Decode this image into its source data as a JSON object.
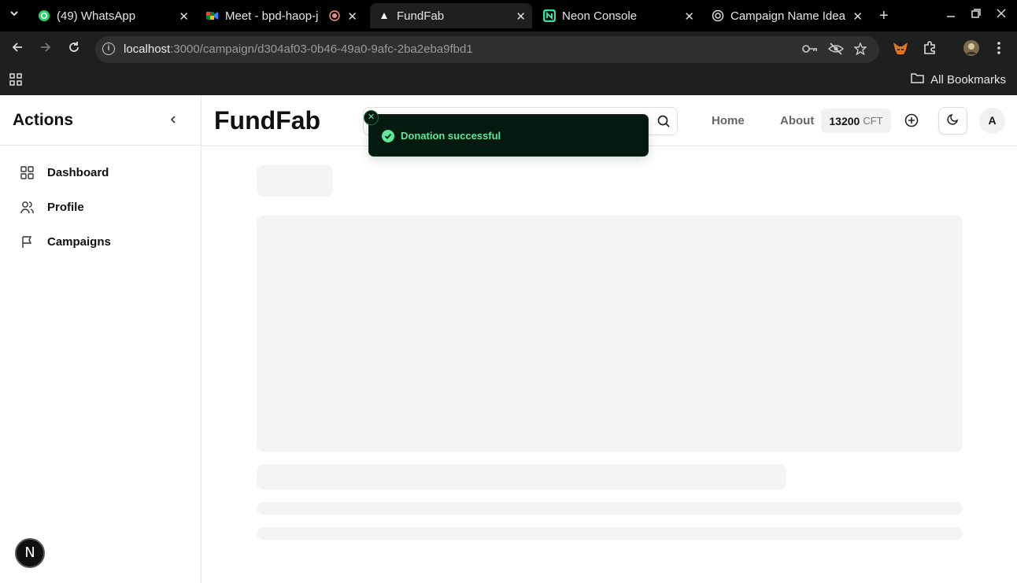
{
  "browser": {
    "tabs": [
      {
        "title": "(49) WhatsApp",
        "icon": "whatsapp-icon"
      },
      {
        "title": "Meet - bpd-haop-j",
        "icon": "google-meet-icon"
      },
      {
        "title": "FundFab",
        "icon": "triangle-icon",
        "active": true
      },
      {
        "title": "Neon Console",
        "icon": "neon-icon"
      },
      {
        "title": "Campaign Name Idea",
        "icon": "openai-icon"
      }
    ],
    "url_host": "localhost",
    "url_path": ":3000/campaign/d304af03-0b46-49a0-9afc-2ba2eba9fbd1",
    "bookmarks_label": "All Bookmarks"
  },
  "sidebar": {
    "title": "Actions",
    "items": [
      {
        "label": "Dashboard",
        "icon": "dashboard-icon"
      },
      {
        "label": "Profile",
        "icon": "users-icon"
      },
      {
        "label": "Campaigns",
        "icon": "flag-icon"
      }
    ]
  },
  "header": {
    "brand": "FundFab",
    "nav": [
      "Home",
      "About"
    ],
    "balance_amount": "13200",
    "balance_unit": "CFT",
    "avatar_initial": "A"
  },
  "toast": {
    "message": "Donation successful",
    "colors": {
      "background": "#04190f",
      "text": "#5ee89a"
    }
  },
  "dev_badge": "N"
}
